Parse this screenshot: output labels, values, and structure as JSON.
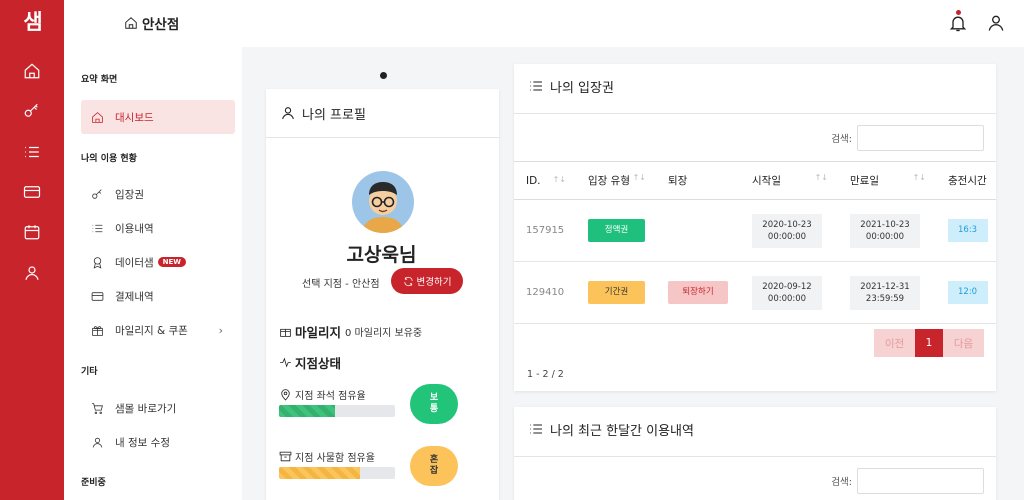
{
  "app": {
    "logo": "샘"
  },
  "header": {
    "title": "안산점"
  },
  "sidebar": {
    "sections": {
      "summary": "요약 화면",
      "usage": "나의 이용 현황",
      "etc": "기타",
      "preparing": "준비중"
    },
    "items": {
      "dashboard": "대시보드",
      "ticket": "입장권",
      "history": "이용내역",
      "datasam": "데이터샘",
      "datasam_badge": "NEW",
      "payment": "결제내역",
      "mileage": "마일리지 & 쿠폰",
      "shop": "샘몰 바로가기",
      "profile_edit": "내 정보 수정"
    }
  },
  "profile": {
    "title": "나의 프로필",
    "name": "고상욱님",
    "branch": "선택 지점 - 안산점",
    "change_button": "변경하기",
    "mileage_label": "마일리지",
    "mileage_value": "0 마일리지 보유중",
    "status_title": "지점상태",
    "seat_label": "지점 좌석 점유율",
    "seat_fraction": 0.48,
    "seat_status": [
      "보",
      "통"
    ],
    "locker_label": "지점 사물함 점유율",
    "locker_fraction": 0.7,
    "locker_status": [
      "혼",
      "잡"
    ]
  },
  "tickets": {
    "title": "나의 입장권",
    "search_label": "검색:",
    "columns": [
      "ID.",
      "입장 유형",
      "퇴장",
      "시작일",
      "만료일",
      "충전시간"
    ],
    "rows": [
      {
        "id": "157915",
        "type": "정액권",
        "exit": "",
        "start": [
          "2020-10-23",
          "00:00:00"
        ],
        "end": [
          "2021-10-23",
          "00:00:00"
        ],
        "charge": "16:3"
      },
      {
        "id": "129410",
        "type": "기간권",
        "exit": "퇴장하기",
        "start": [
          "2020-09-12",
          "00:00:00"
        ],
        "end": [
          "2021-12-31",
          "23:59:59"
        ],
        "charge": "12:0"
      }
    ],
    "pager": {
      "prev": "이전",
      "current": "1",
      "next": "다음"
    },
    "count": "1 - 2 / 2"
  },
  "recent": {
    "title": "나의 최근 한달간 이용내역",
    "search_label": "검색:"
  },
  "colors": {
    "brand": "#c8242b",
    "green": "#22c47a",
    "yellow": "#fcc35a"
  }
}
